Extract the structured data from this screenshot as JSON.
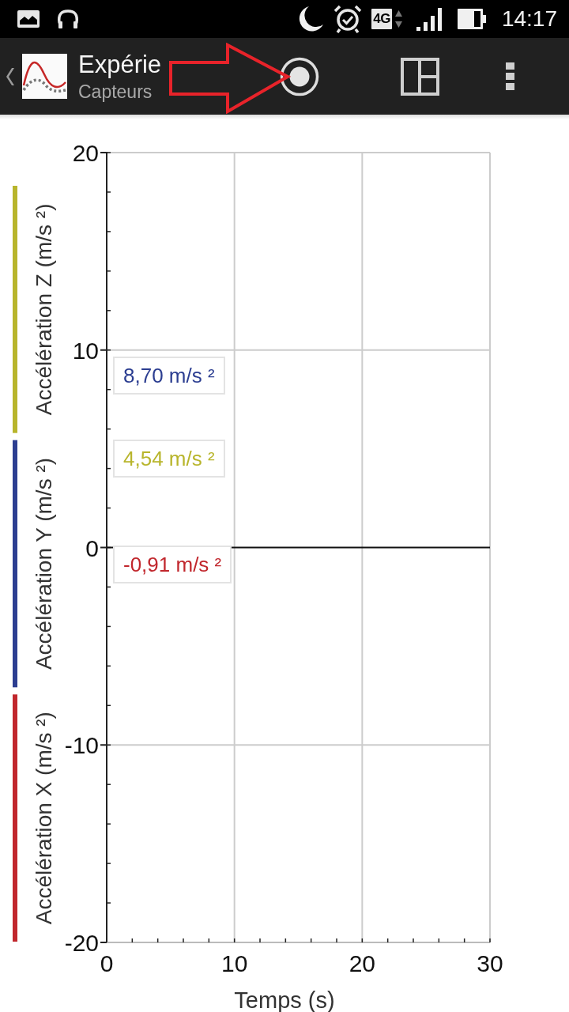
{
  "status_bar": {
    "network": "4G",
    "time": "14:17"
  },
  "app_bar": {
    "title": "Expérie",
    "subtitle": "Capteurs"
  },
  "graph": {
    "y_ticks": [
      "20",
      "10",
      "0",
      "-10",
      "-20"
    ],
    "x_ticks": [
      "0",
      "10",
      "20",
      "30"
    ],
    "x_axis_title": "Temps (s)",
    "channels": [
      {
        "name": "Accélération X (m/s ²)",
        "color": "#c1272d"
      },
      {
        "name": "Accélération Y (m/s ²)",
        "color": "#2c3e91"
      },
      {
        "name": "Accélération Z (m/s ²)",
        "color": "#b8b52c"
      }
    ],
    "readouts": [
      {
        "text": "8,70 m/s ²",
        "color": "#2c3e91"
      },
      {
        "text": "4,54 m/s ²",
        "color": "#b8b52c"
      },
      {
        "text": "-0,91 m/s ²",
        "color": "#c1272d"
      }
    ]
  }
}
